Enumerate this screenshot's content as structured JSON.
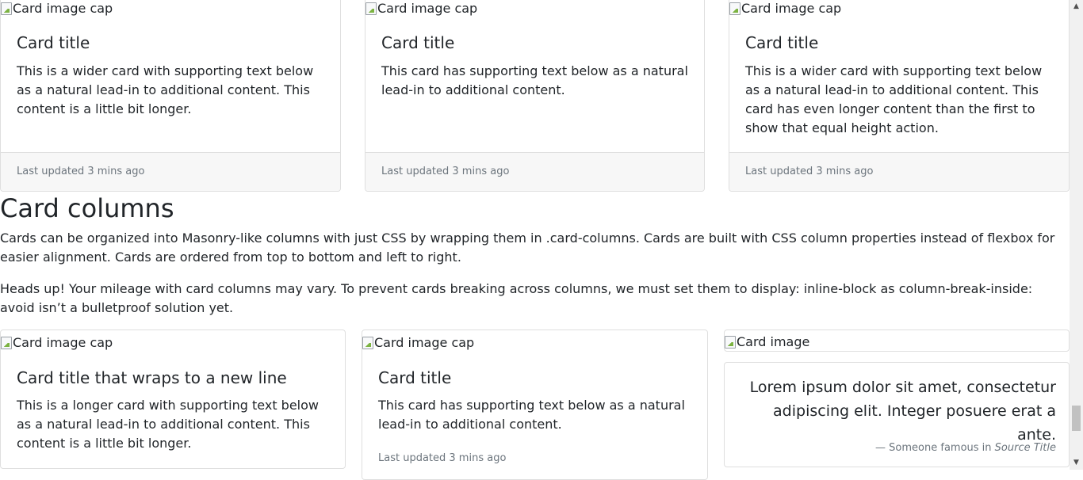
{
  "top_cards": [
    {
      "img_alt": "Card image cap",
      "title": "Card title",
      "text": "This is a wider card with supporting text below as a natural lead-in to additional content. This content is a little bit longer.",
      "footer": "Last updated 3 mins ago"
    },
    {
      "img_alt": "Card image cap",
      "title": "Card title",
      "text": "This card has supporting text below as a natural lead-in to additional content.",
      "footer": "Last updated 3 mins ago"
    },
    {
      "img_alt": "Card image cap",
      "title": "Card title",
      "text": "This is a wider card with supporting text below as a natural lead-in to additional content. This card has even longer content than the first to show that equal height action.",
      "footer": "Last updated 3 mins ago"
    }
  ],
  "section": {
    "heading": "Card columns",
    "paragraph1": "Cards can be organized into Masonry-like columns with just CSS by wrapping them in .card-columns. Cards are built with CSS column properties instead of flexbox for easier alignment. Cards are ordered from top to bottom and left to right.",
    "paragraph2": "Heads up! Your mileage with card columns may vary. To prevent cards breaking across columns, we must set them to display: inline-block as column-break-inside: avoid isn’t a bulletproof solution yet."
  },
  "column_cards": {
    "card1": {
      "img_alt": "Card image cap",
      "title": "Card title that wraps to a new line",
      "text": "This is a longer card with supporting text below as a natural lead-in to additional content. This content is a little bit longer."
    },
    "card2": {
      "img_alt": "Card image cap",
      "title": "Card title",
      "text": "This card has supporting text below as a natural lead-in to additional content.",
      "muted": "Last updated 3 mins ago"
    },
    "card3": {
      "img_alt": "Card image"
    },
    "quote_card": {
      "quote": "Lorem ipsum dolor sit amet, consectetur adipiscing elit. Integer posuere erat a ante.",
      "dash": "—",
      "attribution": "Someone famous in",
      "source": "Source Title"
    }
  },
  "scrollbar": {
    "up_icon": "▲",
    "down_icon": "▼"
  }
}
